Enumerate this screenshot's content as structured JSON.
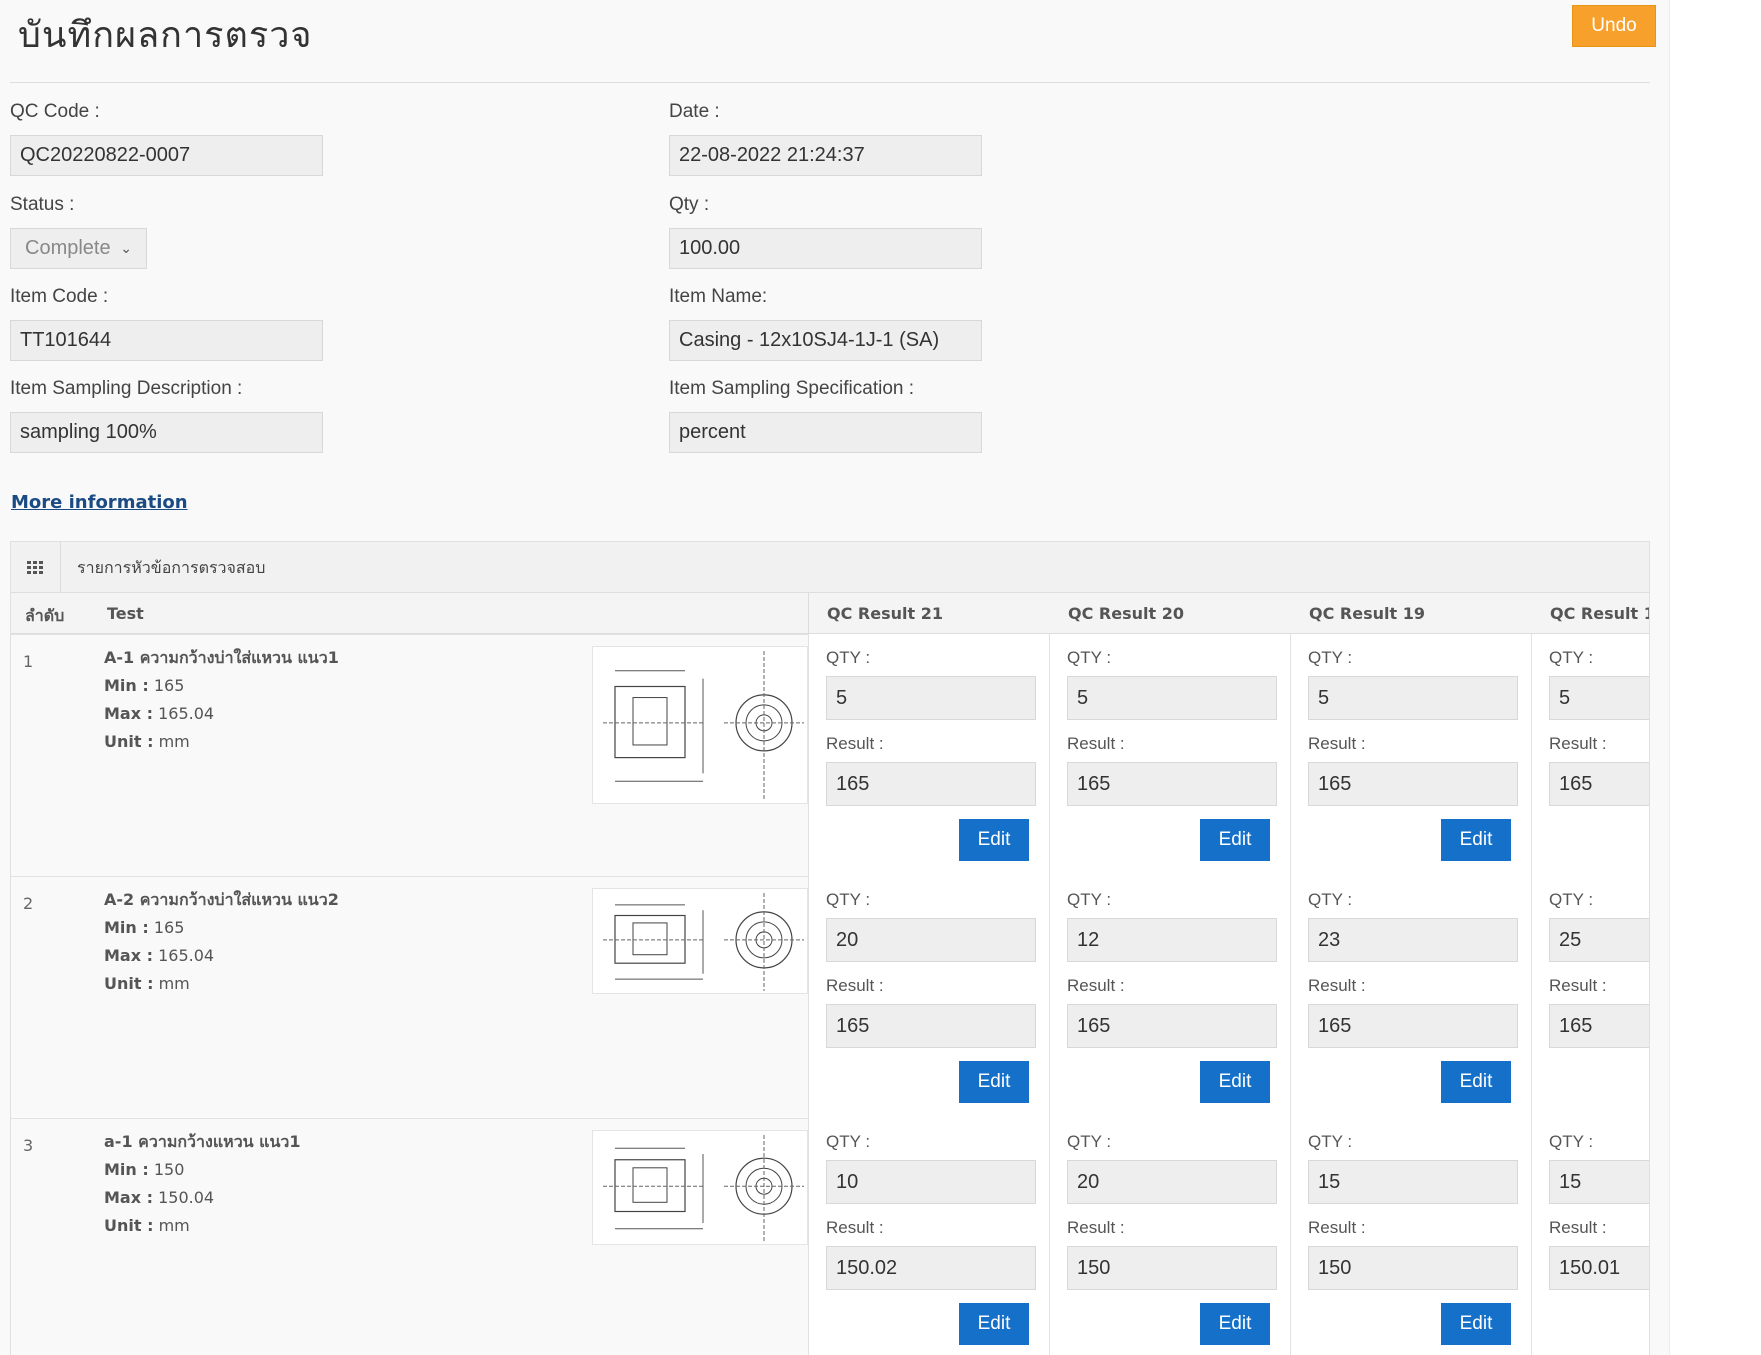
{
  "page": {
    "title": "บันทึกผลการตรวจ",
    "undo_label": "Undo"
  },
  "form": {
    "qc_code_label": "QC Code :",
    "qc_code_value": "QC20220822-0007",
    "date_label": "Date :",
    "date_value": "22-08-2022 21:24:37",
    "status_label": "Status :",
    "status_value": "Complete",
    "qty_label": "Qty :",
    "qty_value": "100.00",
    "item_code_label": "Item Code :",
    "item_code_value": "TT101644",
    "item_name_label": "Item Name:",
    "item_name_value": "Casing - 12x10SJ4-1J-1 (SA)",
    "sampling_desc_label": "Item Sampling Description :",
    "sampling_desc_value": "sampling 100%",
    "sampling_spec_label": "Item Sampling Specification :",
    "sampling_spec_value": "percent"
  },
  "more_info_label": "More information",
  "grid": {
    "title": "รายการหัวข้อการตรวจสอบ",
    "col_no": "ลำดับ",
    "col_test": "Test",
    "result_cols": [
      "QC Result 21",
      "QC Result 20",
      "QC Result 19",
      "QC Result 1"
    ],
    "qty_label": "QTY :",
    "result_label": "Result :",
    "edit_label": "Edit",
    "min_label": "Min :",
    "max_label": "Max :",
    "unit_label": "Unit :",
    "rows": [
      {
        "no": "1",
        "name": "A-1 ความกว้างบ่าใส่แหวน แนว1",
        "min": "165",
        "max": "165.04",
        "unit": "mm",
        "results": [
          {
            "qty": "5",
            "result": "165"
          },
          {
            "qty": "5",
            "result": "165"
          },
          {
            "qty": "5",
            "result": "165"
          },
          {
            "qty": "5",
            "result": "165"
          }
        ]
      },
      {
        "no": "2",
        "name": "A-2 ความกว้างบ่าใส่แหวน แนว2",
        "min": "165",
        "max": "165.04",
        "unit": "mm",
        "results": [
          {
            "qty": "20",
            "result": "165"
          },
          {
            "qty": "12",
            "result": "165"
          },
          {
            "qty": "23",
            "result": "165"
          },
          {
            "qty": "25",
            "result": "165"
          }
        ]
      },
      {
        "no": "3",
        "name": "a-1 ความกว้างแหวน แนว1",
        "min": "150",
        "max": "150.04",
        "unit": "mm",
        "results": [
          {
            "qty": "10",
            "result": "150.02"
          },
          {
            "qty": "20",
            "result": "150"
          },
          {
            "qty": "15",
            "result": "150"
          },
          {
            "qty": "15",
            "result": "150.01"
          }
        ]
      }
    ]
  }
}
